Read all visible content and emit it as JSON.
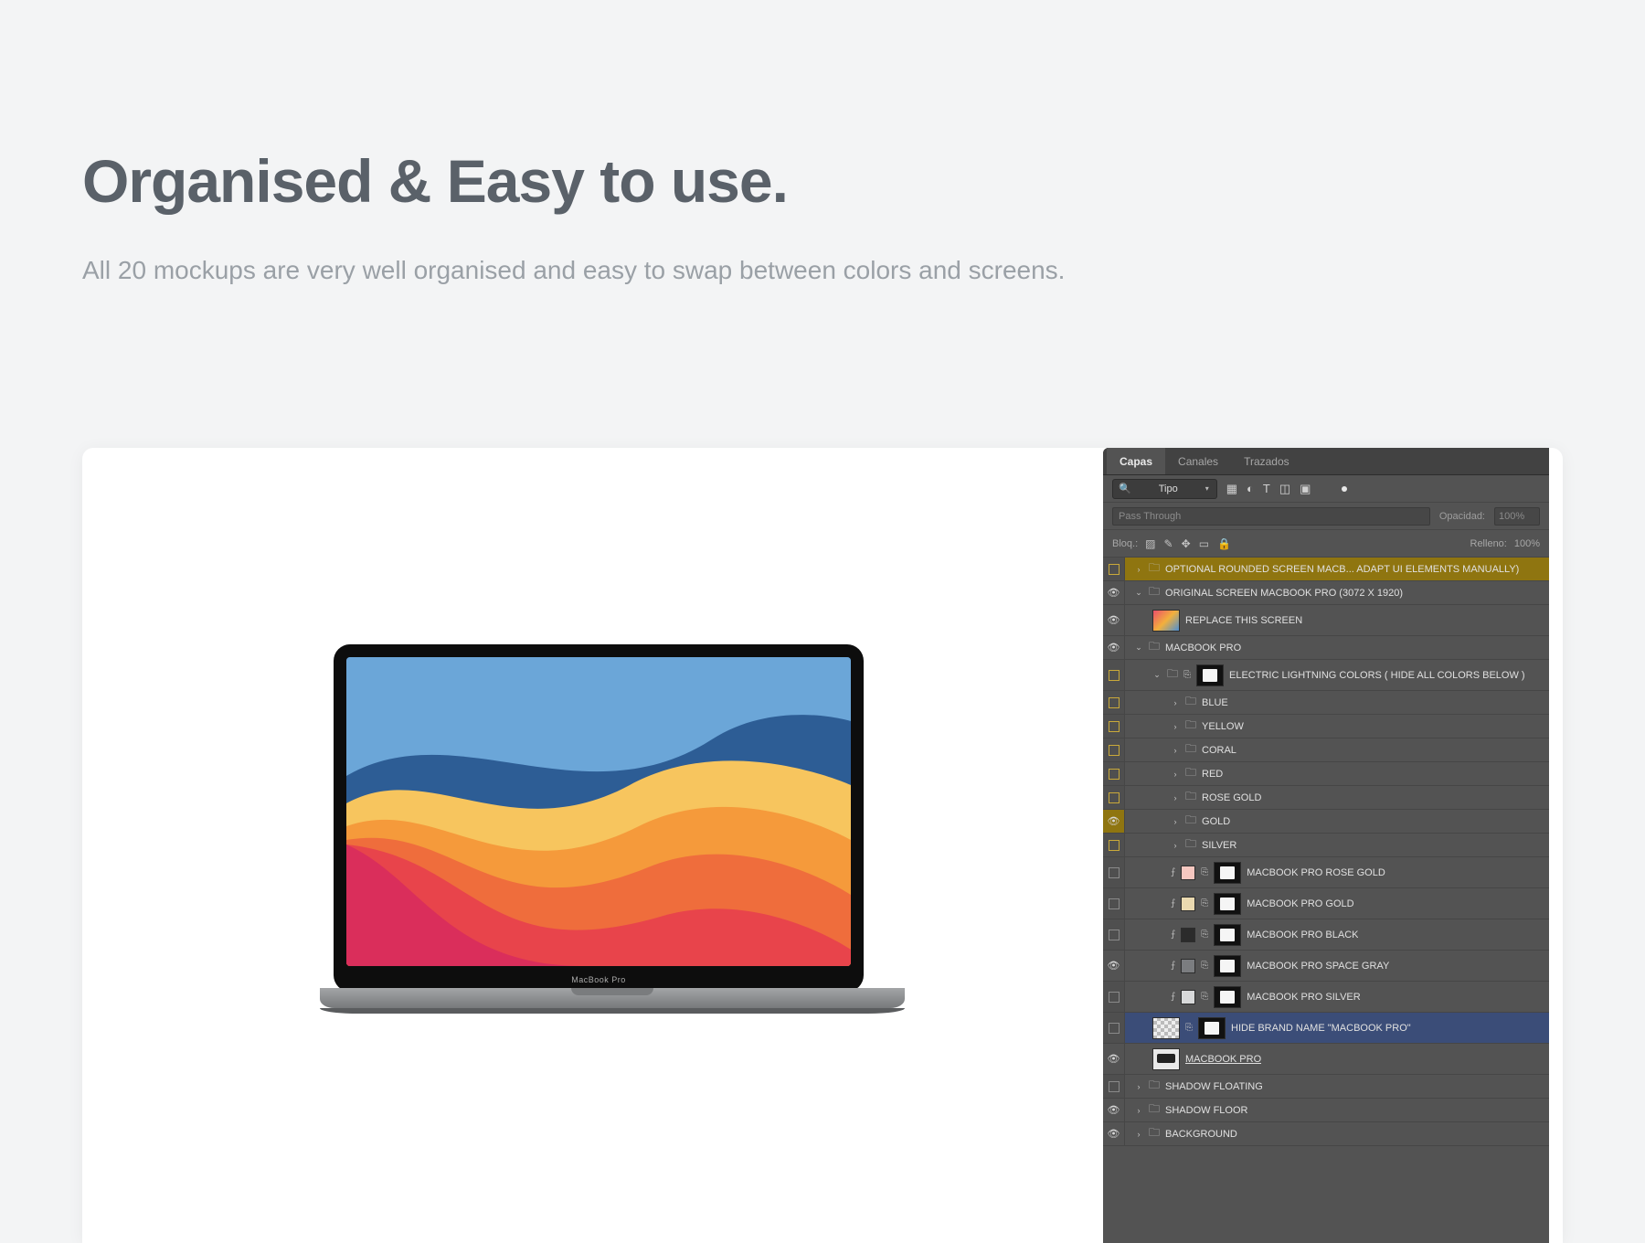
{
  "title": "Organised & Easy to use.",
  "subtitle": "All 20 mockups are very well organised and easy to swap between colors and screens.",
  "mockup": {
    "device_label": "MacBook Pro"
  },
  "panel": {
    "tabs": {
      "layers": "Capas",
      "channels": "Canales",
      "paths": "Trazados"
    },
    "filter": {
      "label": "Tipo"
    },
    "blend": {
      "mode": "Pass Through",
      "opacity_label": "Opacidad:",
      "opacity_value": "100%"
    },
    "lock": {
      "label": "Bloq.:",
      "fill_label": "Relleno:",
      "fill_value": "100%"
    },
    "layers": {
      "l0": "OPTIONAL ROUNDED SCREEN MACB... ADAPT UI ELEMENTS MANUALLY)",
      "l1": "ORIGINAL SCREEN MACBOOK PRO (3072 X 1920)",
      "l2": "REPLACE THIS SCREEN",
      "l3": "MACBOOK PRO",
      "l4": "ELECTRIC LIGHTNING COLORS ( HIDE ALL COLORS BELOW )",
      "l5": "BLUE",
      "l6": "YELLOW",
      "l7": "CORAL",
      "l8": "RED",
      "l9": "ROSE GOLD",
      "l10": "GOLD",
      "l11": "SILVER",
      "m0": "MACBOOK PRO ROSE GOLD",
      "m1": "MACBOOK PRO GOLD",
      "m2": "MACBOOK PRO BLACK",
      "m3": "MACBOOK PRO SPACE GRAY",
      "m4": "MACBOOK PRO SILVER",
      "hide": "HIDE BRAND NAME \"MACBOOK PRO\"",
      "mbp": "MACBOOK PRO",
      "sf": "SHADOW FLOATING",
      "sfl": "SHADOW FLOOR",
      "bg": "BACKGROUND"
    },
    "swatches": {
      "rose_gold": "#f6c7c0",
      "gold": "#ead9b0",
      "black": "#2b2b2b",
      "space_gray": "#7b7d80",
      "silver": "#d8d9da"
    }
  }
}
